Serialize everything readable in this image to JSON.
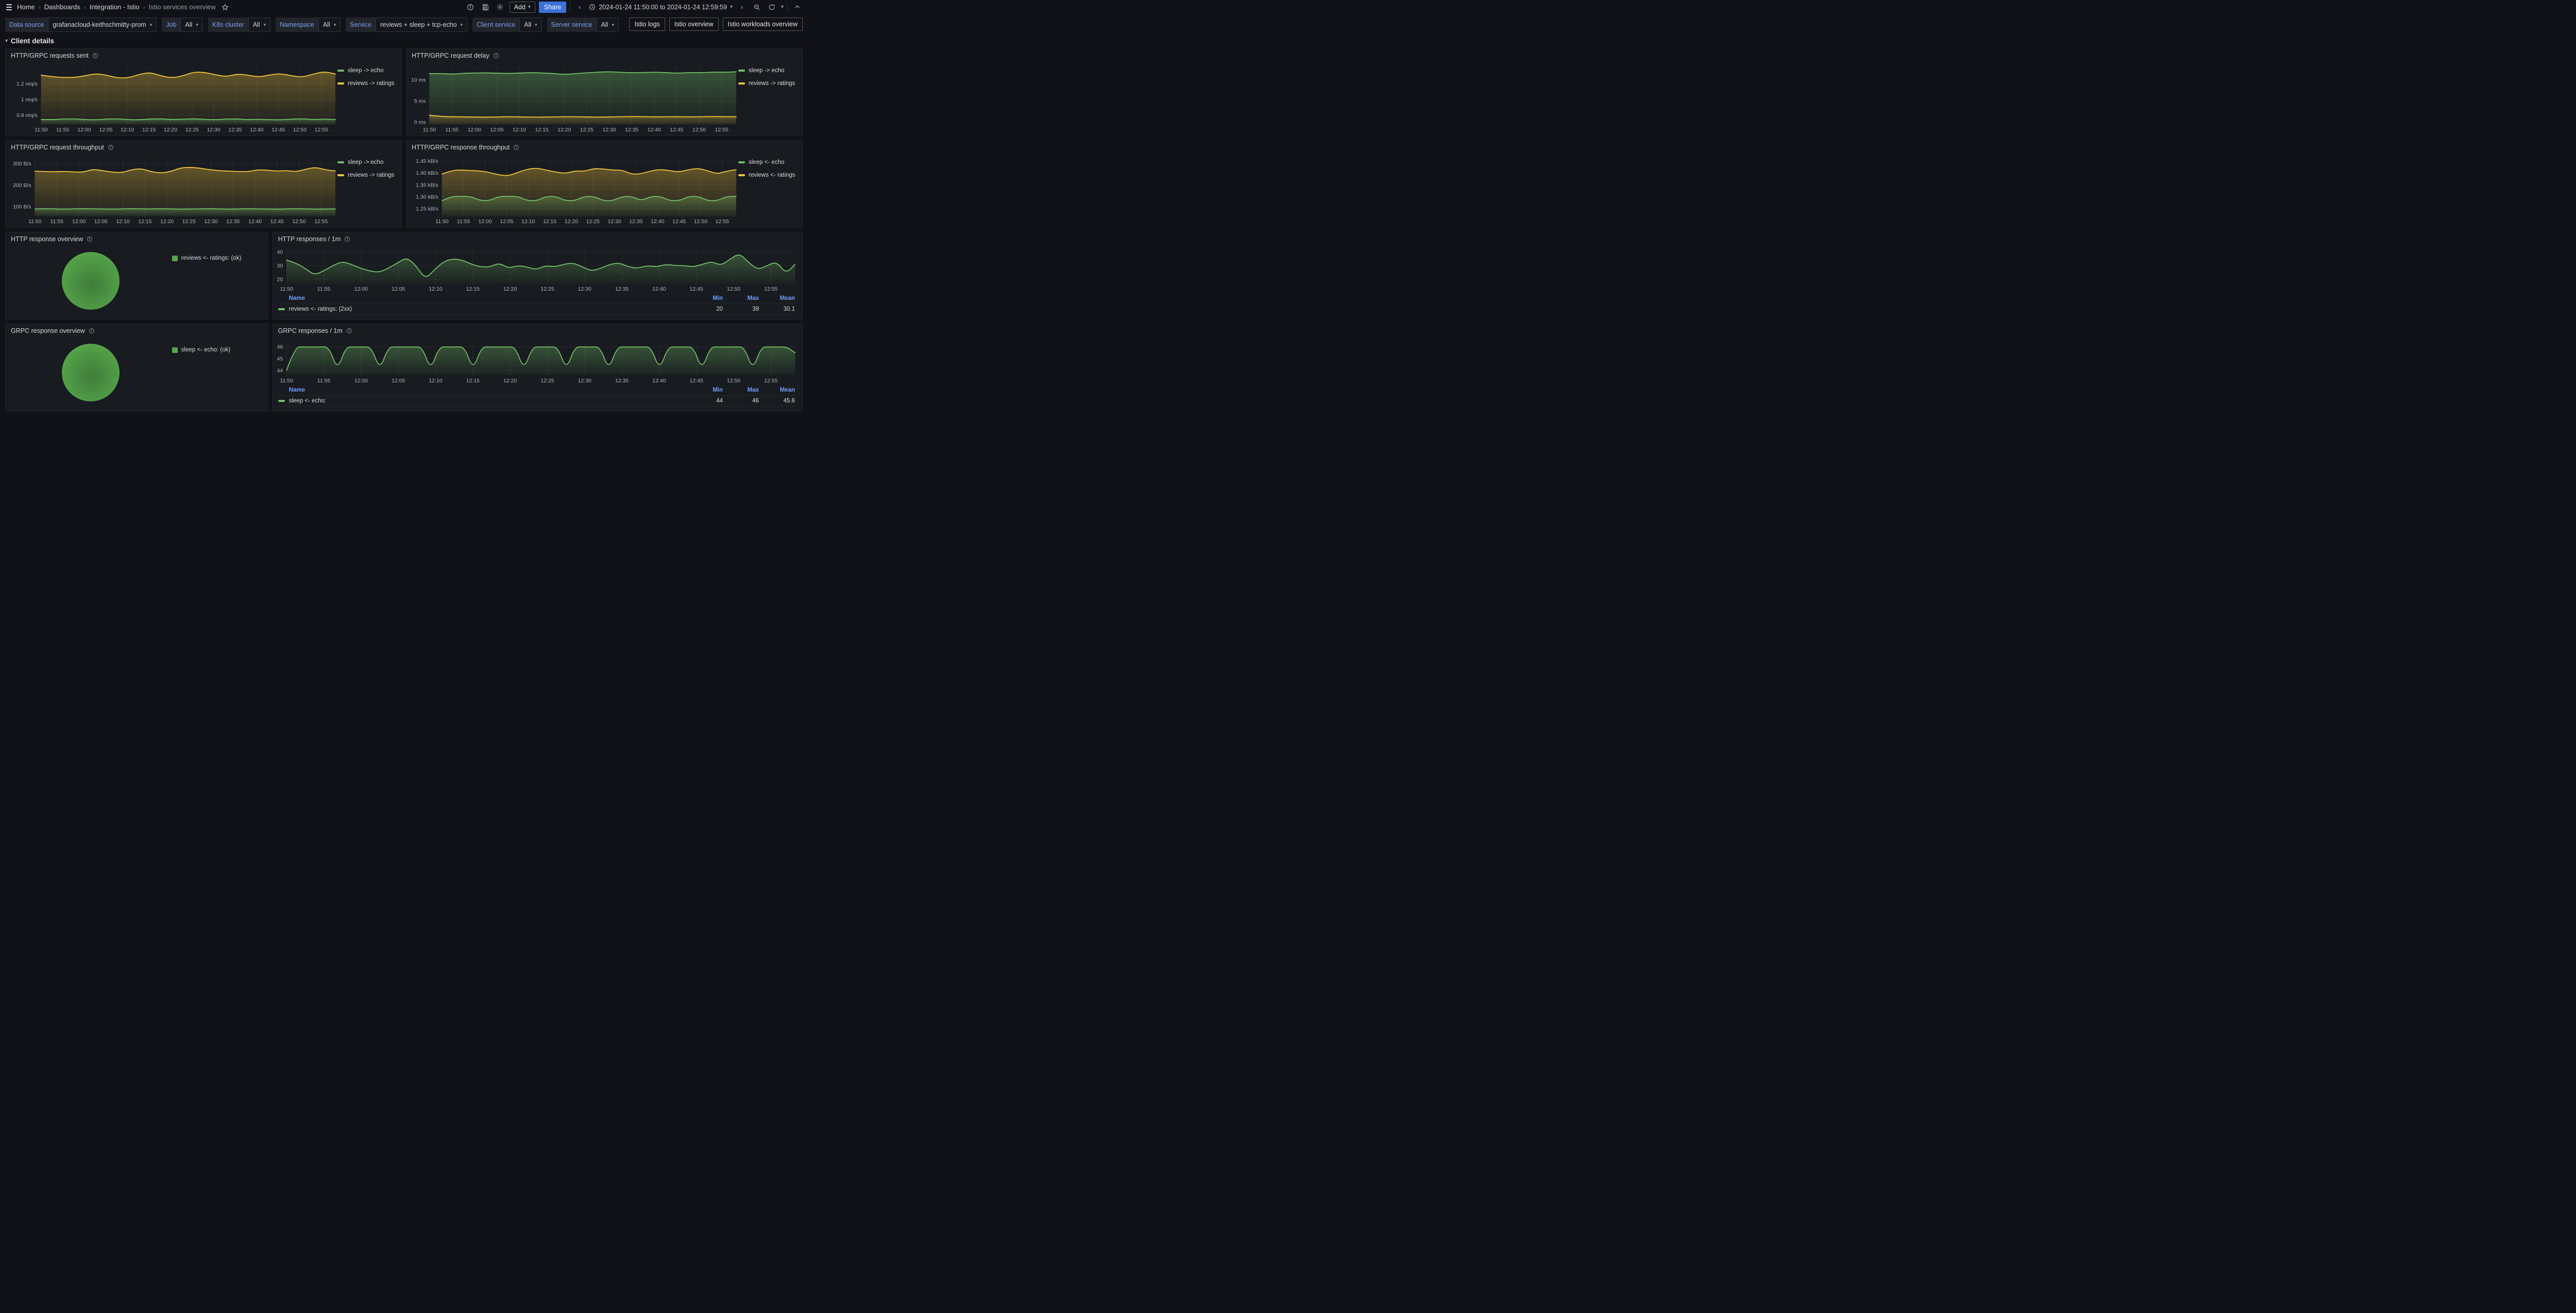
{
  "nav": {
    "breadcrumbs": [
      "Home",
      "Dashboards",
      "Integration - Istio",
      "Istio services overview"
    ],
    "add_label": "Add",
    "share_label": "Share",
    "time_range": "2024-01-24 11:50:00 to 2024-01-24 12:59:59"
  },
  "colors": {
    "green": "#73bf69",
    "yellow": "#f0c43b",
    "pie_green": "#56a64b",
    "pie_green_center": "#3f7c39",
    "accent_blue": "#6e9fff",
    "share_blue": "#3d71d9"
  },
  "filters": {
    "items": [
      {
        "label": "Data source",
        "value": "grafanacloud-keithschmitty-prom"
      },
      {
        "label": "Job",
        "value": "All"
      },
      {
        "label": "K8s cluster",
        "value": "All"
      },
      {
        "label": "Namespace",
        "value": "All"
      },
      {
        "label": "Service",
        "value": "reviews + sleep + tcp-echo"
      },
      {
        "label": "Client service",
        "value": "All"
      },
      {
        "label": "Server service",
        "value": "All"
      }
    ]
  },
  "links": [
    "Istio logs",
    "Istio overview",
    "Istio workloads overview"
  ],
  "section": {
    "title": "Client details"
  },
  "panels": [
    {
      "title": "HTTP/GRPC requests sent"
    },
    {
      "title": "HTTP/GRPC request delay"
    },
    {
      "title": "HTTP/GRPC request throughput"
    },
    {
      "title": "HTTP/GRPC response throughput"
    },
    {
      "title": "HTTP response overview"
    },
    {
      "title": "HTTP responses / 1m"
    },
    {
      "title": "GRPC response overview"
    },
    {
      "title": "GRPC responses / 1m"
    }
  ],
  "chart_data": {
    "requests_sent": {
      "type": "line",
      "title": "HTTP/GRPC requests sent",
      "x_ticks": [
        "11:50",
        "11:55",
        "12:00",
        "12:05",
        "12:10",
        "12:15",
        "12:20",
        "12:25",
        "12:30",
        "12:35",
        "12:40",
        "12:45",
        "12:50",
        "12:55"
      ],
      "y_ticks": [
        {
          "value": 0.8,
          "label": "0.8 req/s"
        },
        {
          "value": 1.0,
          "label": "1 req/s"
        },
        {
          "value": 1.2,
          "label": "1.2 req/s"
        }
      ],
      "y_range": [
        0.68,
        1.42
      ],
      "grid": true,
      "legend_position": "right",
      "series": [
        {
          "name": "sleep -> echo",
          "color": "#73bf69",
          "values": [
            0.745,
            0.745,
            0.752,
            0.755,
            0.745,
            0.742,
            0.752,
            0.755,
            0.744,
            0.742,
            0.753,
            0.755,
            0.745,
            0.75,
            0.756,
            0.747,
            0.743,
            0.752,
            0.754,
            0.744,
            0.75,
            0.744,
            0.742,
            0.752,
            0.755,
            0.745,
            0.752,
            0.746
          ]
        },
        {
          "name": "reviews -> ratings",
          "color": "#f0c43b",
          "values": [
            1.31,
            1.29,
            1.28,
            1.28,
            1.3,
            1.33,
            1.31,
            1.275,
            1.275,
            1.32,
            1.345,
            1.3,
            1.275,
            1.3,
            1.35,
            1.345,
            1.315,
            1.29,
            1.325,
            1.31,
            1.285,
            1.315,
            1.33,
            1.3,
            1.285,
            1.325,
            1.355,
            1.325
          ]
        }
      ]
    },
    "request_delay": {
      "type": "line",
      "title": "HTTP/GRPC request delay",
      "x_ticks": [
        "11:50",
        "11:55",
        "12:00",
        "12:05",
        "12:10",
        "12:15",
        "12:20",
        "12:25",
        "12:30",
        "12:35",
        "12:40",
        "12:45",
        "12:50",
        "12:55"
      ],
      "y_ticks": [
        {
          "value": 0,
          "label": "0 ms"
        },
        {
          "value": 5,
          "label": "5 ms"
        },
        {
          "value": 10,
          "label": "10 ms"
        }
      ],
      "y_range": [
        -0.6,
        13.2
      ],
      "grid": true,
      "legend_position": "right",
      "series": [
        {
          "name": "sleep -> echo",
          "color": "#73bf69",
          "values": [
            11.5,
            11.55,
            11.35,
            11.6,
            11.65,
            11.7,
            11.6,
            11.55,
            11.65,
            11.75,
            11.65,
            11.5,
            11.3,
            11.55,
            11.7,
            11.9,
            11.95,
            11.8,
            11.7,
            11.78,
            11.85,
            11.7,
            11.62,
            11.78,
            11.72,
            11.88,
            11.82,
            11.95
          ]
        },
        {
          "name": "reviews -> ratings",
          "color": "#f0c43b",
          "values": [
            1.65,
            1.35,
            1.28,
            1.26,
            1.22,
            1.2,
            1.24,
            1.3,
            1.26,
            1.2,
            1.2,
            1.26,
            1.3,
            1.28,
            1.24,
            1.2,
            1.25,
            1.3,
            1.34,
            1.3,
            1.26,
            1.3,
            1.3,
            1.26,
            1.3,
            1.34,
            1.3,
            1.3
          ]
        }
      ]
    },
    "request_throughput": {
      "type": "line",
      "title": "HTTP/GRPC request throughput",
      "x_ticks": [
        "11:50",
        "11:55",
        "12:00",
        "12:05",
        "12:10",
        "12:15",
        "12:20",
        "12:25",
        "12:30",
        "12:35",
        "12:40",
        "12:45",
        "12:50",
        "12:55"
      ],
      "y_ticks": [
        {
          "value": 100,
          "label": "100 B/s"
        },
        {
          "value": 200,
          "label": "200 B/s"
        },
        {
          "value": 300,
          "label": "300 B/s"
        }
      ],
      "y_range": [
        55,
        325
      ],
      "grid": true,
      "legend_position": "right",
      "series": [
        {
          "name": "sleep -> echo",
          "color": "#73bf69",
          "values": [
            90,
            91,
            90,
            89,
            90,
            91,
            90,
            90,
            89,
            90,
            91,
            90,
            90,
            91,
            90,
            89,
            90,
            90,
            91,
            90,
            89,
            90,
            91,
            90,
            90,
            89,
            90,
            91,
            90,
            89,
            90,
            90
          ]
        },
        {
          "name": "reviews -> ratings",
          "color": "#f0c43b",
          "values": [
            265,
            263,
            262,
            264,
            261,
            260,
            274,
            267,
            260,
            258,
            272,
            277,
            262,
            256,
            263,
            280,
            283,
            279,
            272,
            267,
            265,
            263,
            262,
            272,
            269,
            265,
            268,
            262,
            275,
            283,
            271,
            266
          ]
        }
      ]
    },
    "response_throughput": {
      "type": "line",
      "title": "HTTP/GRPC response throughput",
      "x_ticks": [
        "11:50",
        "11:55",
        "12:00",
        "12:05",
        "12:10",
        "12:15",
        "12:20",
        "12:25",
        "12:30",
        "12:35",
        "12:40",
        "12:45",
        "12:50",
        "12:55"
      ],
      "y_ticks": [
        {
          "value": 1.25,
          "label": "1.25 kB/s"
        },
        {
          "value": 1.3,
          "label": "1.30 kB/s"
        },
        {
          "value": 1.35,
          "label": "1.35 kB/s"
        },
        {
          "value": 1.4,
          "label": "1.40 kB/s"
        },
        {
          "value": 1.45,
          "label": "1.45 kB/s"
        }
      ],
      "y_range": [
        1.218,
        1.462
      ],
      "grid": true,
      "legend_position": "right",
      "series": [
        {
          "name": "sleep <- echo",
          "color": "#73bf69",
          "values": [
            1.284,
            1.302,
            1.302,
            1.302,
            1.285,
            1.284,
            1.302,
            1.302,
            1.302,
            1.284,
            1.284,
            1.302,
            1.302,
            1.284,
            1.284,
            1.302,
            1.302,
            1.284,
            1.284,
            1.302,
            1.302,
            1.284,
            1.302,
            1.302,
            1.284,
            1.284,
            1.302,
            1.302,
            1.284,
            1.284,
            1.302,
            1.302
          ]
        },
        {
          "name": "reviews <- ratings",
          "color": "#f0c43b",
          "values": [
            1.396,
            1.41,
            1.413,
            1.41,
            1.409,
            1.402,
            1.392,
            1.388,
            1.403,
            1.416,
            1.421,
            1.412,
            1.404,
            1.398,
            1.409,
            1.407,
            1.419,
            1.417,
            1.412,
            1.412,
            1.394,
            1.397,
            1.409,
            1.415,
            1.41,
            1.404,
            1.414,
            1.42,
            1.409,
            1.396,
            1.408,
            1.414
          ]
        }
      ]
    },
    "http_response_overview": {
      "type": "pie",
      "title": "HTTP response overview",
      "slices": [
        {
          "name": "reviews <- ratings: (ok)",
          "value": 100,
          "color": "#56a64b",
          "center_color": "#3f7c39"
        }
      ],
      "legend_position": "right"
    },
    "http_responses": {
      "type": "line",
      "title": "HTTP responses / 1m",
      "x_ticks": [
        "11:50",
        "11:55",
        "12:00",
        "12:05",
        "12:10",
        "12:15",
        "12:20",
        "12:25",
        "12:30",
        "12:35",
        "12:40",
        "12:45",
        "12:50",
        "12:55"
      ],
      "y_ticks": [
        {
          "value": 20,
          "label": "20"
        },
        {
          "value": 30,
          "label": "30"
        },
        {
          "value": 40,
          "label": "40"
        }
      ],
      "y_range": [
        16.5,
        41.5
      ],
      "grid": true,
      "legend_position": "table",
      "series": [
        {
          "name": "reviews <- ratings: (2xx)",
          "color": "#73bf69",
          "values": [
            34,
            32,
            28,
            23,
            26,
            30,
            33,
            31,
            28,
            26,
            25,
            28,
            32,
            36,
            30,
            20,
            27,
            33,
            35,
            34,
            31,
            29,
            29,
            32,
            28,
            30,
            29,
            27,
            30,
            29,
            31,
            32,
            29,
            26,
            28,
            31,
            32,
            29,
            28,
            30,
            29,
            31,
            30,
            30,
            29,
            31,
            33,
            30,
            35,
            39,
            32,
            27,
            30,
            33,
            24,
            31
          ]
        }
      ],
      "table": {
        "name_header": "Name",
        "headers": [
          "Min",
          "Max",
          "Mean"
        ],
        "row": {
          "name": "reviews <- ratings: (2xx)",
          "min": "20",
          "max": "39",
          "mean": "30.1"
        }
      }
    },
    "grpc_response_overview": {
      "type": "pie",
      "title": "GRPC response overview",
      "slices": [
        {
          "name": "sleep <- echo: (ok)",
          "value": 100,
          "color": "#56a64b",
          "center_color": "#3f7c39"
        }
      ],
      "legend_position": "right"
    },
    "grpc_responses": {
      "type": "line",
      "title": "GRPC responses / 1m",
      "x_ticks": [
        "11:50",
        "11:55",
        "12:00",
        "12:05",
        "12:10",
        "12:15",
        "12:20",
        "12:25",
        "12:30",
        "12:35",
        "12:40",
        "12:45",
        "12:50",
        "12:55"
      ],
      "y_ticks": [
        {
          "value": 44,
          "label": "44"
        },
        {
          "value": 45,
          "label": "45"
        },
        {
          "value": 46,
          "label": "46"
        }
      ],
      "y_range": [
        43.55,
        46.45
      ],
      "grid": true,
      "legend_position": "table",
      "series": [
        {
          "name": "sleep <- echo:",
          "color": "#73bf69",
          "values": [
            44,
            46,
            46,
            46,
            46,
            46,
            44,
            46,
            46,
            46,
            46,
            44,
            46,
            46,
            46,
            46,
            46,
            44,
            46,
            46,
            46,
            46,
            44,
            46,
            46,
            46,
            46,
            46,
            44,
            46,
            46,
            46,
            46,
            44,
            46,
            46,
            46,
            46,
            44,
            46,
            46,
            46,
            46,
            46,
            44,
            46,
            46,
            46,
            46,
            44,
            46,
            46,
            46,
            46,
            46,
            44,
            46,
            46,
            46,
            46,
            45.5
          ]
        }
      ],
      "table": {
        "name_header": "Name",
        "headers": [
          "Min",
          "Max",
          "Mean"
        ],
        "row": {
          "name": "sleep <- echo:",
          "min": "44",
          "max": "46",
          "mean": "45.6"
        }
      }
    }
  }
}
